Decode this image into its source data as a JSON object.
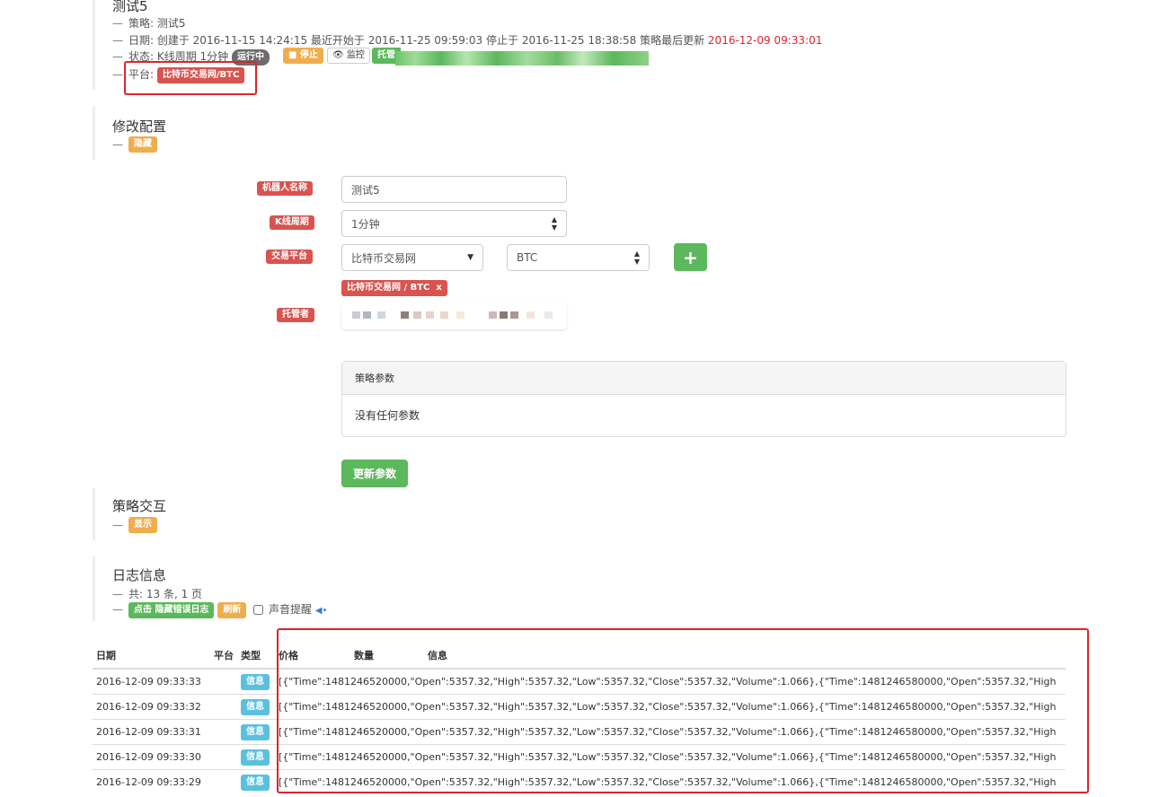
{
  "header": {
    "title": "测试5",
    "strategy_line": "策略: 测试5",
    "date_prefix": "日期: 创建于 2016-11-15 14:24:15 最近开始于 2016-11-25 09:59:03 停止于 2016-11-25 18:38:58 策略最后更新",
    "date_updated": "2016-12-09 09:33:01",
    "status_prefix": "状态: K线周期 1分钟",
    "status_running": "运行中",
    "stop_button": "■ 停止",
    "monitor_button": "监控",
    "hosted_label": "托管",
    "platform_prefix": "平台:",
    "platform_badge": "比特币交易网/BTC"
  },
  "config": {
    "title": "修改配置",
    "hide_label": "隐藏",
    "robot_name_label": "机器人名称",
    "robot_name_value": "测试5",
    "kline_label": "K线周期",
    "kline_value": "1分钟",
    "exchange_label": "交易平台",
    "exchange_value": "比特币交易网",
    "currency_value": "BTC",
    "add_button": "+",
    "selected_exchange_tag": "比特币交易网 / BTC",
    "selected_exchange_remove": "x",
    "host_label": "托管者",
    "params_panel_title": "策略参数",
    "params_panel_body": "没有任何参数",
    "update_button": "更新参数"
  },
  "interaction": {
    "title": "策略交互",
    "show_label": "显示"
  },
  "log": {
    "title": "日志信息",
    "count_text": "共: 13 条, 1 页",
    "toggle_error_button": "点击 隐藏错误日志",
    "refresh_button": "刷新",
    "sound_alert_label": "声音提醒",
    "columns": [
      "日期",
      "平台",
      "类型",
      "价格",
      "数量",
      "信息"
    ],
    "rows": [
      {
        "date": "2016-12-09 09:33:33",
        "type": "信息",
        "info": "[{\"Time\":1481246520000,\"Open\":5357.32,\"High\":5357.32,\"Low\":5357.32,\"Close\":5357.32,\"Volume\":1.066},{\"Time\":1481246580000,\"Open\":5357.32,\"High"
      },
      {
        "date": "2016-12-09 09:33:32",
        "type": "信息",
        "info": "[{\"Time\":1481246520000,\"Open\":5357.32,\"High\":5357.32,\"Low\":5357.32,\"Close\":5357.32,\"Volume\":1.066},{\"Time\":1481246580000,\"Open\":5357.32,\"High"
      },
      {
        "date": "2016-12-09 09:33:31",
        "type": "信息",
        "info": "[{\"Time\":1481246520000,\"Open\":5357.32,\"High\":5357.32,\"Low\":5357.32,\"Close\":5357.32,\"Volume\":1.066},{\"Time\":1481246580000,\"Open\":5357.32,\"High"
      },
      {
        "date": "2016-12-09 09:33:30",
        "type": "信息",
        "info": "[{\"Time\":1481246520000,\"Open\":5357.32,\"High\":5357.32,\"Low\":5357.32,\"Close\":5357.32,\"Volume\":1.066},{\"Time\":1481246580000,\"Open\":5357.32,\"High"
      },
      {
        "date": "2016-12-09 09:33:29",
        "type": "信息",
        "info": "[{\"Time\":1481246520000,\"Open\":5357.32,\"High\":5357.32,\"Low\":5357.32,\"Close\":5357.32,\"Volume\":1.066},{\"Time\":1481246580000,\"Open\":5357.32,\"High"
      }
    ]
  },
  "colors": {
    "danger": "#d9534f",
    "warning": "#f0ad4e",
    "success": "#5cb85c",
    "info": "#5bc0de",
    "highlight_red": "#d9262c"
  }
}
